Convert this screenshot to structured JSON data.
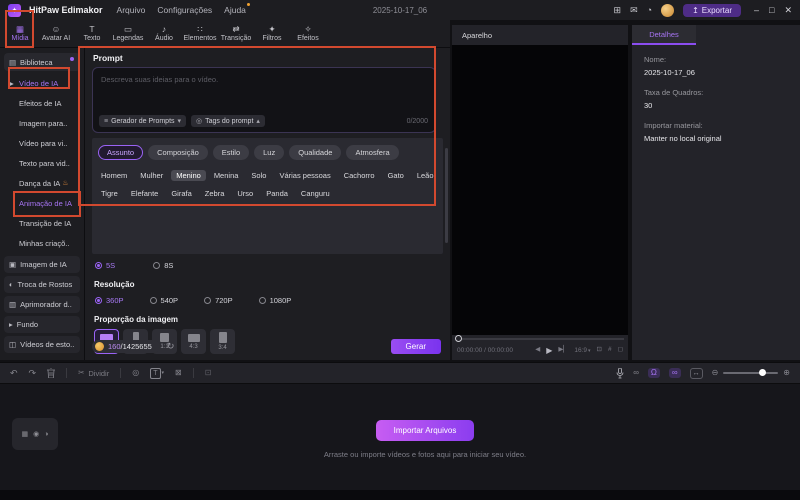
{
  "colors": {
    "accent": "#9a63f5",
    "annotation": "#d2492f",
    "coin_gold": "#d98f2b",
    "generate_gradient": [
      "#9a4df2",
      "#7a33ee"
    ],
    "import_gradient": [
      "#c75df2",
      "#8b3def"
    ]
  },
  "titlebar": {
    "app_name": "HitPaw Edimakor",
    "menu_items": [
      "Arquivo",
      "Configurações",
      "Ajuda"
    ],
    "project_title": "2025-10-17_06",
    "export_label": "Exportar"
  },
  "icons": {
    "logo": "✦",
    "panels": "⊞",
    "feedback": "✉",
    "history": "◔",
    "export_arrow": "↥",
    "minimize": "–",
    "maximize": "□",
    "close": "✕",
    "generator": "≡",
    "tags_button": "◎",
    "caret_down": "▾",
    "caret_up": "▴",
    "refresh": "↻",
    "undo": "↶",
    "redo": "↷",
    "trash": "🗑",
    "scissors": "✂",
    "marker": "◎",
    "text_tool": "T",
    "delete_text": "⊠",
    "sticker": "⊡",
    "link": "∞",
    "magnet": "Ω",
    "chain": "∞",
    "fit": "↔",
    "zoom_out": "⊖",
    "zoom_in": "⊕",
    "prev_frame": "◀",
    "play": "▶",
    "next_frame": "▶▏",
    "snapshot": "⊡",
    "crop": "#",
    "fullscreen": "◻",
    "video_track": "▦",
    "audio_track": "◉",
    "text_track": "◑"
  },
  "tabs": {
    "active": "Mídia",
    "items": [
      {
        "label": "Mídia",
        "icon": "▦"
      },
      {
        "label": "Avatar AI",
        "icon": "☺"
      },
      {
        "label": "Texto",
        "icon": "T"
      },
      {
        "label": "Legendas",
        "icon": "▭"
      },
      {
        "label": "Áudio",
        "icon": "♪"
      },
      {
        "label": "Elementos",
        "icon": "∷"
      },
      {
        "label": "Transição",
        "icon": "⇄"
      },
      {
        "label": "Filtros",
        "icon": "✦"
      },
      {
        "label": "Efeitos",
        "icon": "✧"
      }
    ]
  },
  "sidebar": {
    "items": [
      {
        "label": "Biblioteca",
        "icon": "▤"
      },
      {
        "label": "Vídeo de IA",
        "icon": "▶"
      },
      {
        "label": "Efeitos de IA"
      },
      {
        "label": "Imagem para.."
      },
      {
        "label": "Vídeo para vi.."
      },
      {
        "label": "Texto para vid.."
      },
      {
        "label": "Dança da IA",
        "badge": "♨"
      },
      {
        "label": "Animação de IA"
      },
      {
        "label": "Transição de IA"
      },
      {
        "label": "Minhas criaçõ.."
      }
    ],
    "tools": [
      {
        "label": "Imagem de IA",
        "icon": "▣"
      },
      {
        "label": "Troca de Rostos",
        "icon": "◐"
      },
      {
        "label": "Aprimorador d..",
        "icon": "▥"
      },
      {
        "label": "Fundo",
        "icon": "▸"
      },
      {
        "label": "Vídeos de esto..",
        "icon": "◫"
      }
    ]
  },
  "prompt": {
    "label": "Prompt",
    "placeholder": "Descreva suas ideias para o vídeo.",
    "generator_button": "Gerador de Prompts",
    "tags_button": "Tags do prompt",
    "char_count": "0/2000"
  },
  "tagsPanel": {
    "active_category": "Assunto",
    "categories": [
      "Assunto",
      "Composição",
      "Estilo",
      "Luz",
      "Qualidade",
      "Atmosfera"
    ],
    "selected_tag": "Menino",
    "tags": [
      "Homem",
      "Mulher",
      "Menino",
      "Menina",
      "Solo",
      "Várias pessoas",
      "Cachorro",
      "Gato",
      "Leão",
      "Tigre",
      "Elefante",
      "Girafa",
      "Zebra",
      "Urso",
      "Panda",
      "Canguru"
    ]
  },
  "duration": {
    "options": [
      "5S",
      "8S"
    ],
    "selected": "5S"
  },
  "resolution": {
    "label": "Resolução",
    "options": [
      "360P",
      "540P",
      "720P",
      "1080P"
    ],
    "selected": "360P"
  },
  "aspect_ratio": {
    "label": "Proporção da imagem",
    "options": [
      "16:9",
      "9:16",
      "1:1",
      "4:3",
      "3:4"
    ],
    "selected": "16:9"
  },
  "credits": {
    "used": "160",
    "total": "/1425655"
  },
  "generate": {
    "label": "Gerar"
  },
  "preview": {
    "title": "Aparelho",
    "time": "00:00:00 / 00:00:00",
    "ratio": "16:9"
  },
  "details": {
    "tab": "Detalhes",
    "name_label": "Nome:",
    "name_value": "2025-10-17_06",
    "fps_label": "Taxa de Quadros:",
    "fps_value": "30",
    "import_label": "Importar material:",
    "import_value": "Manter no local original"
  },
  "timeline_toolbar": {
    "divide_label": "Dividir"
  },
  "import_area": {
    "button_label": "Importar Arquivos",
    "hint": "Arraste ou importe vídeos e fotos aqui para iniciar seu vídeo."
  }
}
